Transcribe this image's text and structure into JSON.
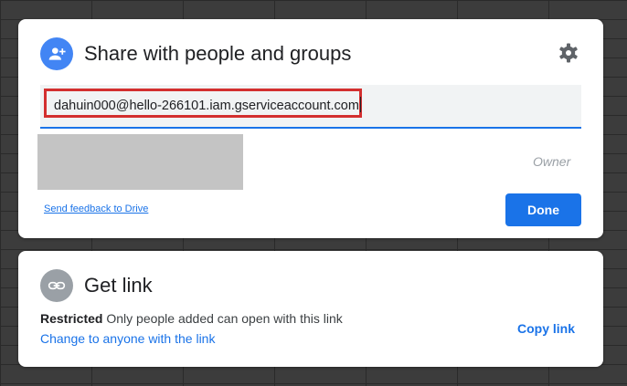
{
  "share_dialog": {
    "title": "Share with people and groups",
    "icon": "person-add-icon",
    "settings_icon": "gear-icon",
    "input_value": "dahuin000@hello-266101.iam.gserviceaccount.com",
    "owner_label": "Owner",
    "feedback_link": "Send feedback to Drive",
    "done_label": "Done"
  },
  "link_dialog": {
    "title": "Get link",
    "icon": "link-icon",
    "restricted_label": "Restricted",
    "restricted_desc": "Only people added can open with this link",
    "change_link": "Change to anyone with the link",
    "copy_link": "Copy link"
  },
  "colors": {
    "accent": "#1a73e8",
    "share_avatar_bg": "#4285f4",
    "link_avatar_bg": "#9aa0a6",
    "highlight_box": "#d32f2f",
    "background": "#3c3c3c"
  }
}
